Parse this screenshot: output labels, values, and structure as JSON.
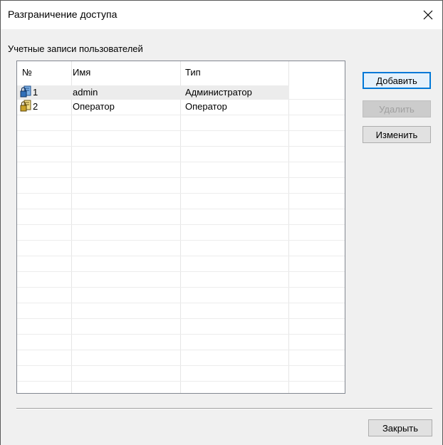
{
  "window": {
    "title": "Разграничение доступа"
  },
  "group": {
    "label": "Учетные записи пользователей"
  },
  "table": {
    "columns": [
      "№",
      "Имя",
      "Тип"
    ],
    "rows": [
      {
        "num": "1",
        "name": "admin",
        "type": "Администратор",
        "icon": "user-admin-icon"
      },
      {
        "num": "2",
        "name": "Оператор",
        "type": "Оператор",
        "icon": "user-operator-icon"
      }
    ]
  },
  "buttons": {
    "add": "Добавить",
    "delete": "Удалить",
    "edit": "Изменить",
    "close": "Закрыть"
  },
  "colors": {
    "accent": "#0078d7",
    "admin_icon": "#2f6fb8",
    "operator_icon": "#c9a227"
  }
}
